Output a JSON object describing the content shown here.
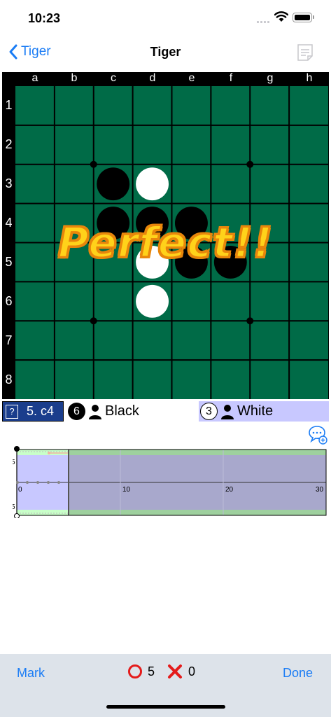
{
  "status_bar": {
    "time": "10:23"
  },
  "nav": {
    "back_label": "Tiger",
    "title": "Tiger"
  },
  "board": {
    "columns": [
      "a",
      "b",
      "c",
      "d",
      "e",
      "f",
      "g",
      "h"
    ],
    "rows": [
      "1",
      "2",
      "3",
      "4",
      "5",
      "6",
      "7",
      "8"
    ],
    "colors": {
      "board": "#006b47",
      "line": "#000000"
    },
    "discs": [
      {
        "cell": "c3",
        "color": "black"
      },
      {
        "cell": "d3",
        "color": "white"
      },
      {
        "cell": "c4",
        "color": "black"
      },
      {
        "cell": "d4",
        "color": "black"
      },
      {
        "cell": "e4",
        "color": "black"
      },
      {
        "cell": "d5",
        "color": "white"
      },
      {
        "cell": "e5",
        "color": "black"
      },
      {
        "cell": "f5",
        "color": "black"
      },
      {
        "cell": "d6",
        "color": "white"
      }
    ],
    "star_points": [
      "c3",
      "g3",
      "c7",
      "g7"
    ]
  },
  "overlay": {
    "text": "Perfect!!"
  },
  "info": {
    "hint_icon": "?",
    "move": "5. c4",
    "black": {
      "count": "6",
      "name": "Black"
    },
    "white": {
      "count": "3",
      "name": "White"
    }
  },
  "graph": {
    "y_tick_top": "5",
    "y_tick_bottom": "5",
    "x_ticks": [
      "0",
      "10",
      "20",
      "30"
    ]
  },
  "toolbar": {
    "mark_label": "Mark",
    "correct_count": "5",
    "wrong_count": "0",
    "done_label": "Done"
  }
}
